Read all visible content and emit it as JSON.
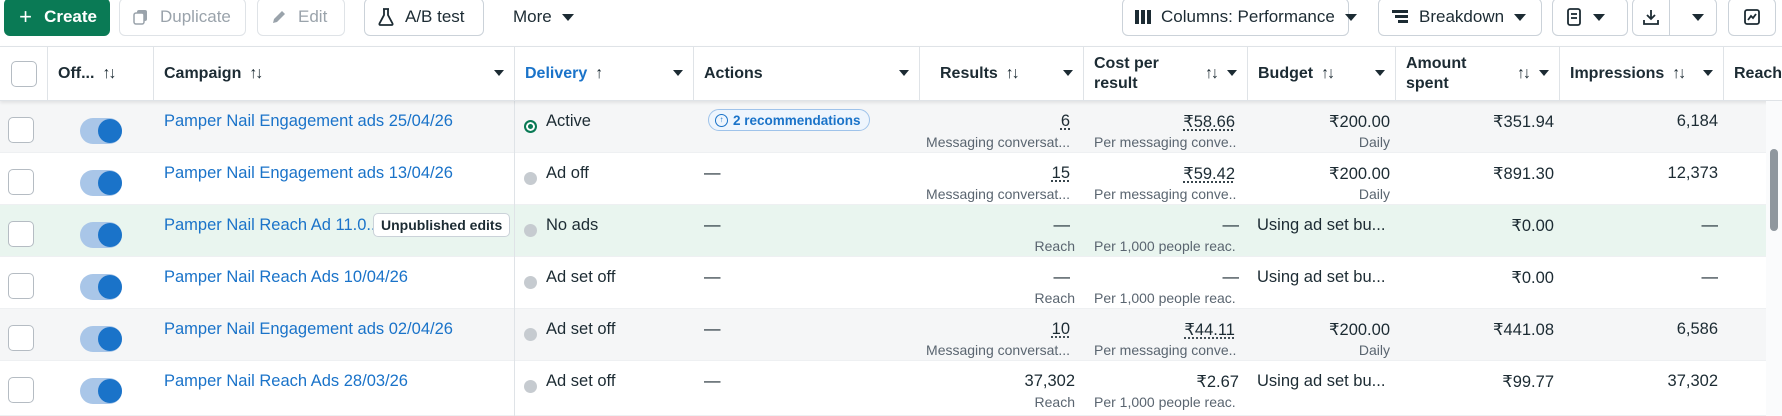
{
  "toolbar": {
    "create": "Create",
    "duplicate": "Duplicate",
    "edit": "Edit",
    "ab_test": "A/B test",
    "more": "More",
    "columns": "Columns: Performance",
    "breakdown": "Breakdown"
  },
  "columns": {
    "off": "Off...",
    "campaign": "Campaign",
    "delivery": "Delivery",
    "actions": "Actions",
    "results": "Results",
    "cost_per_result_1": "Cost per",
    "cost_per_result_2": "result",
    "budget": "Budget",
    "amount_spent_1": "Amount",
    "amount_spent_2": "spent",
    "impressions": "Impressions",
    "reach": "Reach"
  },
  "rows": [
    {
      "campaign": "Pamper Nail Engagement ads 25/04/26",
      "delivery": "Active",
      "actions": "2 recommendations",
      "results": "6",
      "results_sub": "Messaging conversat...",
      "cost": "₹58.66",
      "cost_sub": "Per messaging conve...",
      "budget": "₹200.00",
      "budget_sub": "Daily",
      "spent": "₹351.94",
      "impressions": "6,184"
    },
    {
      "campaign": "Pamper Nail Engagement ads 13/04/26",
      "delivery": "Ad off",
      "actions": "—",
      "results": "15",
      "results_sub": "Messaging conversat...",
      "cost": "₹59.42",
      "cost_sub": "Per messaging conve...",
      "budget": "₹200.00",
      "budget_sub": "Daily",
      "spent": "₹891.30",
      "impressions": "12,373"
    },
    {
      "campaign": "Pamper Nail Reach Ad 11.0...",
      "badge": "Unpublished edits",
      "delivery": "No ads",
      "actions": "—",
      "results": "—",
      "results_sub": "Reach",
      "cost": "—",
      "cost_sub": "Per 1,000 people reac...",
      "budget": "Using ad set bu...",
      "spent": "₹0.00",
      "impressions": "—"
    },
    {
      "campaign": "Pamper Nail Reach Ads 10/04/26",
      "delivery": "Ad set off",
      "actions": "—",
      "results": "—",
      "results_sub": "Reach",
      "cost": "—",
      "cost_sub": "Per 1,000 people reac...",
      "budget": "Using ad set bu...",
      "spent": "₹0.00",
      "impressions": "—"
    },
    {
      "campaign": "Pamper Nail Engagement ads 02/04/26",
      "delivery": "Ad set off",
      "actions": "—",
      "results": "10",
      "results_sub": "Messaging conversat...",
      "cost": "₹44.11",
      "cost_sub": "Per messaging conve...",
      "budget": "₹200.00",
      "budget_sub": "Daily",
      "spent": "₹441.08",
      "impressions": "6,586"
    },
    {
      "campaign": "Pamper Nail Reach Ads 28/03/26",
      "delivery": "Ad set off",
      "actions": "—",
      "results": "37,302",
      "results_sub": "Reach",
      "cost": "₹2.67",
      "cost_sub": "Per 1,000 people reac...",
      "budget": "Using ad set bu...",
      "spent": "₹99.77",
      "impressions": "37,302"
    }
  ],
  "colors": {
    "primary": "#0a7a55",
    "link": "#1a73c9",
    "highlight_row": "#e9f5ef"
  }
}
